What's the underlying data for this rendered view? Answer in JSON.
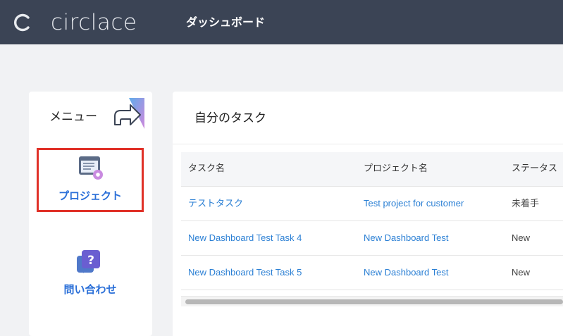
{
  "header": {
    "brand": "circlace",
    "page_title": "ダッシュボード"
  },
  "sidebar": {
    "title": "メニュー",
    "items": [
      {
        "label": "プロジェクト",
        "icon": "project-settings-icon",
        "selected": true
      },
      {
        "label": "問い合わせ",
        "icon": "question-chat-icon",
        "selected": false
      }
    ]
  },
  "tasks": {
    "title": "自分のタスク",
    "columns": [
      "タスク名",
      "プロジェクト名",
      "ステータス"
    ],
    "rows": [
      {
        "task": "テストタスク",
        "project": "Test project for customer",
        "status": "未着手"
      },
      {
        "task": "New Dashboard Test Task 4",
        "project": "New Dashboard Test",
        "status": "New"
      },
      {
        "task": "New Dashboard Test Task 5",
        "project": "New Dashboard Test",
        "status": "New"
      }
    ]
  },
  "colors": {
    "header_bg": "#3b4455",
    "link": "#2a7fd4",
    "highlight_border": "#e03128"
  }
}
